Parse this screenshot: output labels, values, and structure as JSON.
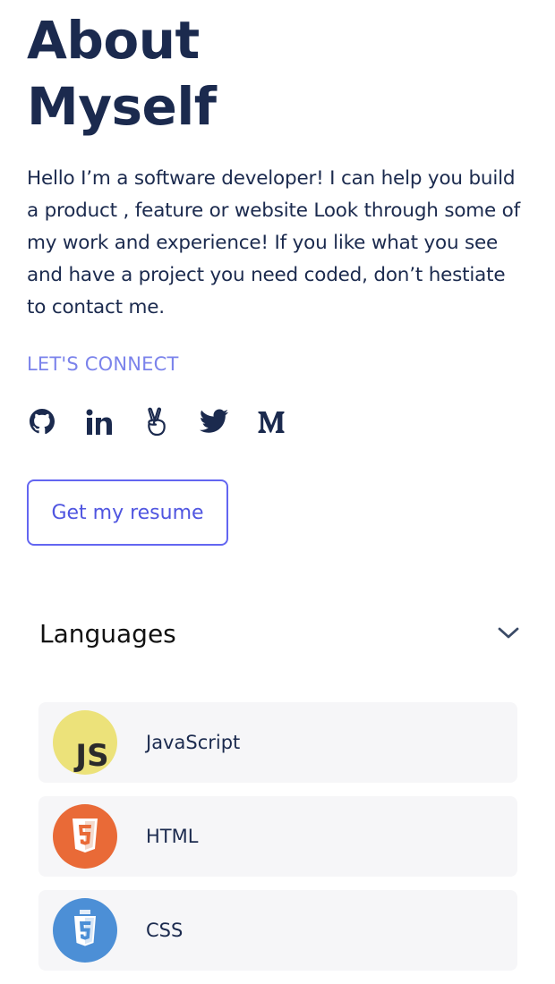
{
  "about": {
    "title_line1": "About",
    "title_line2": "Myself",
    "intro": "Hello I’m a software developer! I can help you build a product , feature or website Look through some of my work and experience! If you like what you see and have a project you need coded, don’t hestiate to contact me.",
    "connect_label": "LET'S CONNECT",
    "resume_button": "Get my resume"
  },
  "socials": [
    {
      "icon": "github-icon"
    },
    {
      "icon": "linkedin-icon"
    },
    {
      "icon": "angellist-icon"
    },
    {
      "icon": "twitter-icon"
    },
    {
      "icon": "medium-icon"
    }
  ],
  "languages": {
    "heading": "Languages",
    "toggle_icon": "chevron-down-icon",
    "items": [
      {
        "name": "JavaScript",
        "icon": "javascript-logo",
        "color": "#ece27a"
      },
      {
        "name": "HTML",
        "icon": "html5-logo",
        "color": "#e96a37"
      },
      {
        "name": "CSS",
        "icon": "css3-logo",
        "color": "#4c8fd6"
      }
    ]
  },
  "colors": {
    "heading": "#1b2a4e",
    "accent": "#6366f1",
    "connect": "#7b83eb",
    "card_bg": "#f6f6f8"
  }
}
